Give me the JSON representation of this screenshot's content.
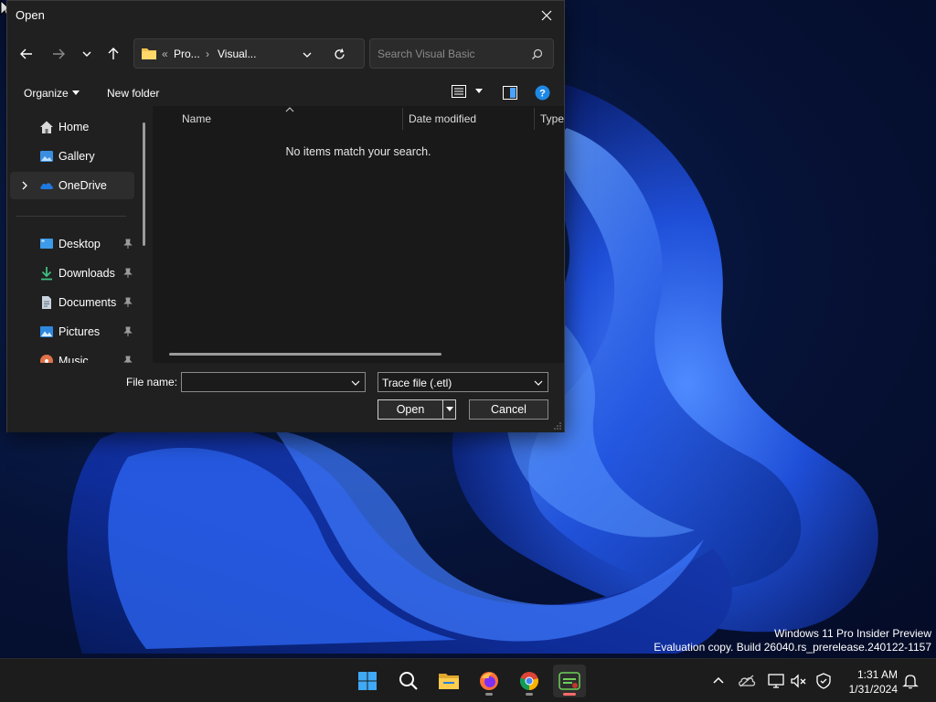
{
  "dialog": {
    "title": "Open",
    "address": {
      "overflow": "«",
      "crumbs": [
        "Pro...",
        "Visual..."
      ],
      "separator": "›"
    },
    "search_placeholder": "Search Visual Basic",
    "toolbar": {
      "organize_label": "Organize",
      "new_folder_label": "New folder"
    },
    "nav_pane": {
      "items": [
        {
          "label": "Home",
          "icon": "home-icon"
        },
        {
          "label": "Gallery",
          "icon": "gallery-icon"
        },
        {
          "label": "OneDrive",
          "icon": "onedrive-icon",
          "selected": true,
          "expandable": true
        },
        {
          "label": "Desktop",
          "icon": "desktop-icon",
          "pinned": true
        },
        {
          "label": "Downloads",
          "icon": "downloads-icon",
          "pinned": true
        },
        {
          "label": "Documents",
          "icon": "documents-icon",
          "pinned": true
        },
        {
          "label": "Pictures",
          "icon": "pictures-icon",
          "pinned": true
        },
        {
          "label": "Music",
          "icon": "music-icon",
          "pinned": true
        }
      ]
    },
    "file_list": {
      "columns": [
        "Name",
        "Date modified",
        "Type"
      ],
      "sort_column": "Name",
      "empty_message": "No items match your search."
    },
    "file_name_label": "File name:",
    "file_name_value": "",
    "file_type_selected": "Trace file (.etl)",
    "open_label": "Open",
    "cancel_label": "Cancel"
  },
  "desktop": {
    "watermark_line1": "Windows 11 Pro Insider Preview",
    "watermark_line2": "Evaluation copy. Build 26040.rs_prerelease.240122-1157"
  },
  "taskbar": {
    "apps": [
      {
        "name": "start-button",
        "icon": "windows-logo-icon"
      },
      {
        "name": "search-button",
        "icon": "search-icon"
      },
      {
        "name": "file-explorer",
        "icon": "folder-icon"
      },
      {
        "name": "firefox",
        "icon": "firefox-icon",
        "running": true
      },
      {
        "name": "chrome",
        "icon": "chrome-icon",
        "running": true
      },
      {
        "name": "active-app",
        "icon": "app-icon",
        "running": true,
        "active": true
      }
    ],
    "tray": [
      "chevron-up-icon",
      "onedrive-cloud-icon",
      "network-icon",
      "volume-muted-icon",
      "security-icon"
    ],
    "time": "1:31 AM",
    "date": "1/31/2024"
  },
  "colors": {
    "accent": "#0078d4",
    "dialog_bg": "#202020",
    "list_bg": "#191919",
    "taskbar_bg": "#1c1c1c"
  }
}
